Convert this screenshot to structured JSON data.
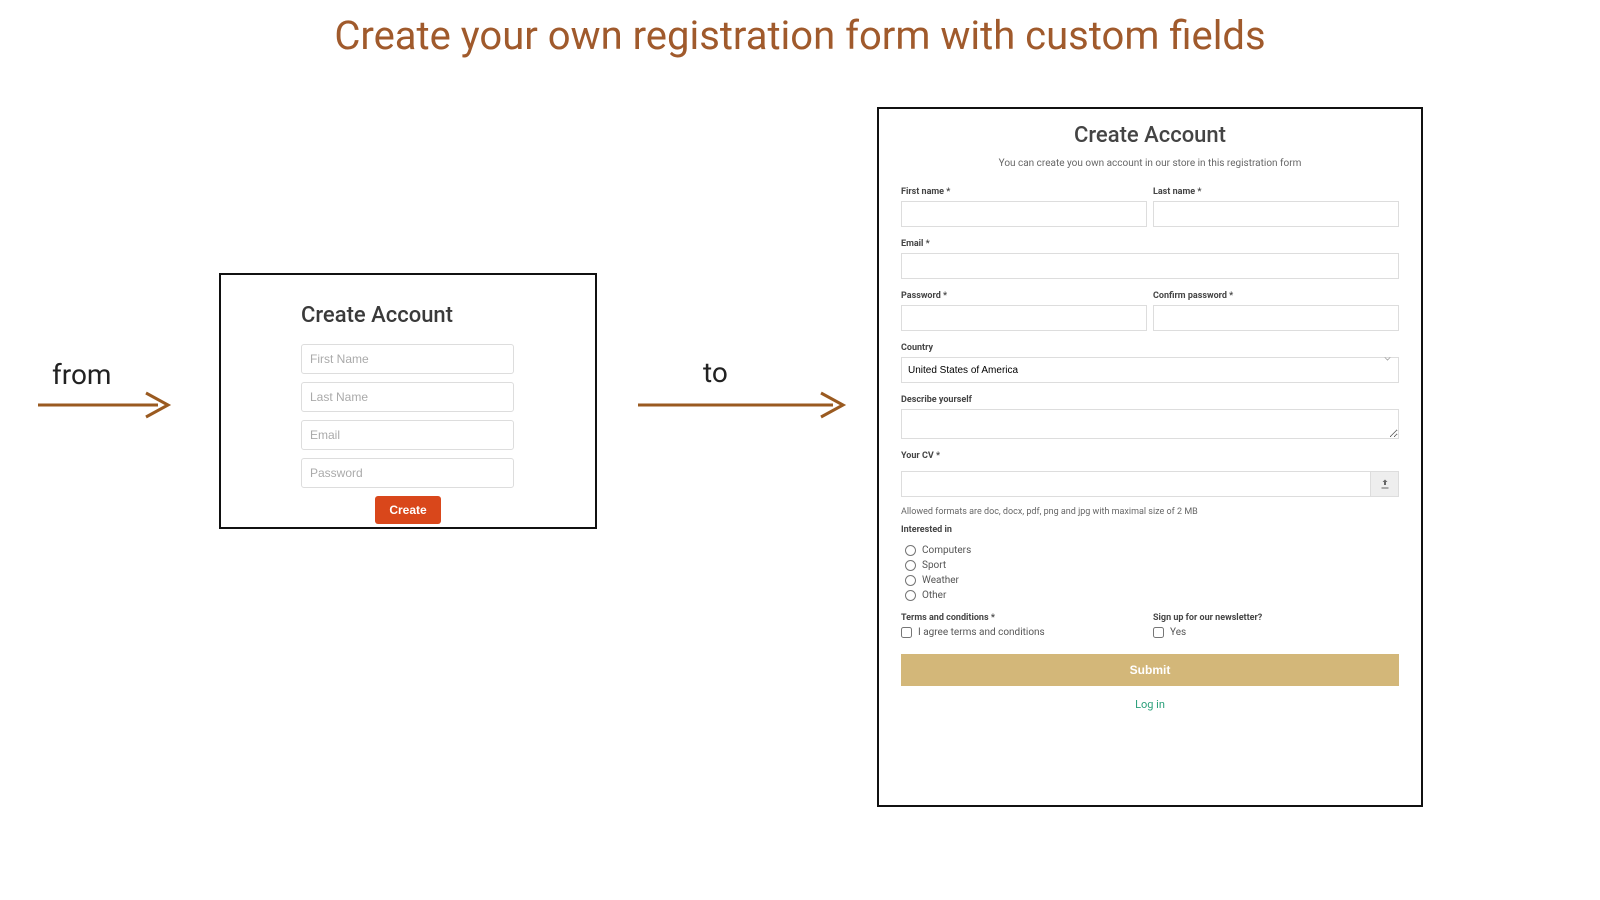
{
  "headline": "Create your own registration form with custom fields",
  "labels": {
    "from": "from",
    "to": "to"
  },
  "simple": {
    "title": "Create Account",
    "first_name_ph": "First Name",
    "last_name_ph": "Last Name",
    "email_ph": "Email",
    "password_ph": "Password",
    "create_btn": "Create"
  },
  "extended": {
    "title": "Create Account",
    "subtitle": "You can create you own account in our store in this registration form",
    "first_name_lbl": "First name *",
    "last_name_lbl": "Last name *",
    "email_lbl": "Email *",
    "password_lbl": "Password *",
    "confirm_password_lbl": "Confirm password *",
    "country_lbl": "Country",
    "country_value": "United States of America",
    "describe_lbl": "Describe yourself",
    "cv_lbl": "Your CV *",
    "cv_hint": "Allowed formats are doc, docx, pdf, png and jpg with maximal size of 2 MB",
    "interested_lbl": "Interested in",
    "interested_options": [
      "Computers",
      "Sport",
      "Weather",
      "Other"
    ],
    "terms_lbl": "Terms and conditions *",
    "terms_check": "I agree terms and conditions",
    "newsletter_lbl": "Sign up for our newsletter?",
    "newsletter_check": "Yes",
    "submit_btn": "Submit",
    "login_link": "Log in"
  }
}
